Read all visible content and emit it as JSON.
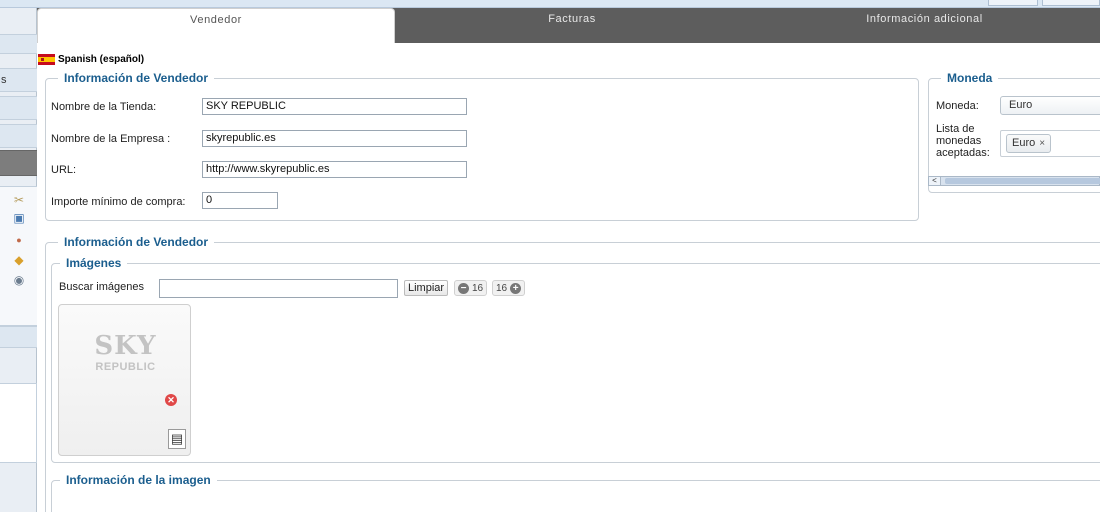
{
  "tabs": [
    {
      "label": "Vendedor",
      "active": true
    },
    {
      "label": "Facturas",
      "active": false
    },
    {
      "label": "Información adicional",
      "active": false
    }
  ],
  "sidebar": {
    "partial_label": "s",
    "icons": [
      "tools-icon",
      "image-icon",
      "paint-icon",
      "bag-icon",
      "globe-icon"
    ]
  },
  "language": {
    "flag": "spain-flag-icon",
    "label": "Spanish (español)"
  },
  "vendor_info": {
    "legend": "Información de Vendedor",
    "store_name_label": "Nombre de la Tienda:",
    "store_name_value": "SKY REPUBLIC",
    "company_label": "Nombre de la Empresa :",
    "company_value": "skyrepublic.es",
    "url_label": "URL:",
    "url_value": "http://www.skyrepublic.es",
    "min_purchase_label": "Importe mínimo de compra:",
    "min_purchase_value": "0"
  },
  "currency": {
    "legend": "Moneda",
    "currency_label": "Moneda:",
    "currency_value": "Euro",
    "accepted_label_lines": [
      "Lista de",
      "monedas",
      "aceptadas:"
    ],
    "accepted_chip": "Euro",
    "chip_remove": "×",
    "scroll_arrow": "<"
  },
  "vendor_images": {
    "legend": "Información de Vendedor",
    "images_legend": "Imágenes",
    "search_label": "Buscar imágenes",
    "search_value": "",
    "clear_button": "Limpiar",
    "size_minus": "16",
    "size_plus": "16",
    "logo_line1": "SKY",
    "logo_line2": "REPUBLIC",
    "image_info_legend": "Información de la imagen"
  }
}
